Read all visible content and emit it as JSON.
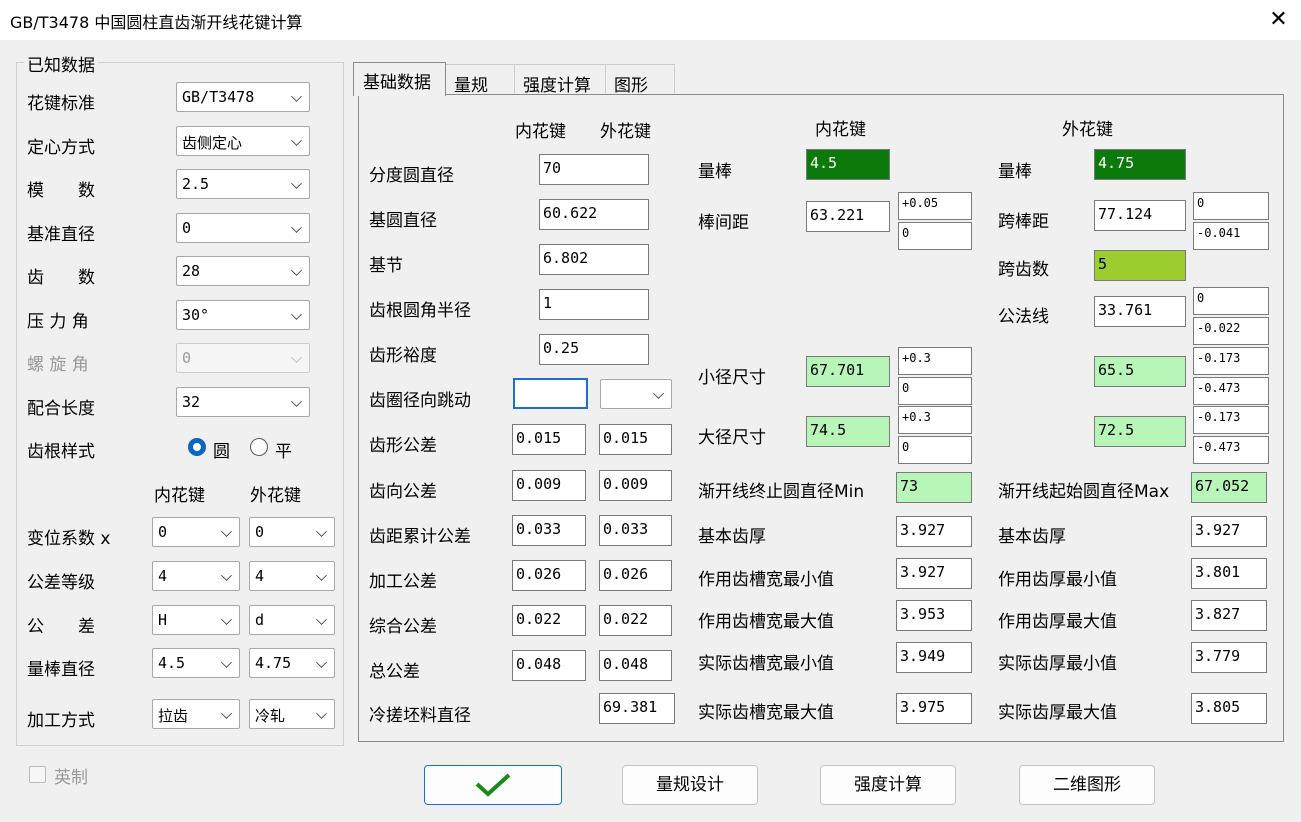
{
  "window": {
    "title": "GB/T3478 中国圆柱直齿渐开线花键计算",
    "close_glyph": "✕"
  },
  "known": {
    "group_title": "已知数据",
    "spline_standard": {
      "label": "花键标准",
      "value": "GB/T3478"
    },
    "centering": {
      "label": "定心方式",
      "value": "齿侧定心"
    },
    "module": {
      "label": "模　　数",
      "value": "2.5"
    },
    "ref_diameter": {
      "label": "基准直径",
      "value": "0"
    },
    "teeth": {
      "label": "齿　　数",
      "value": "28"
    },
    "pressure_angle": {
      "label": "压 力 角",
      "value": "30°"
    },
    "helix_angle": {
      "label": "螺 旋 角",
      "value": "0"
    },
    "fit_length": {
      "label": "配合长度",
      "value": "32"
    },
    "root_style": {
      "label": "齿根样式",
      "opt1": "圆",
      "opt2": "平",
      "selected": "圆"
    },
    "col_internal": "内花键",
    "col_external": "外花键",
    "shift": {
      "label": "变位系数 x",
      "internal": "0",
      "external": "0"
    },
    "tol_grade": {
      "label": "公差等级",
      "internal": "4",
      "external": "4"
    },
    "tolerance": {
      "label": "公　　差",
      "internal": "H",
      "external": "d"
    },
    "pin_dia": {
      "label": "量棒直径",
      "internal": "4.5",
      "external": "4.75"
    },
    "process": {
      "label": "加工方式",
      "internal": "拉齿",
      "external": "冷轧"
    },
    "imperial": "英制"
  },
  "tabs": [
    "基础数据",
    "量规",
    "强度计算",
    "图形"
  ],
  "basic": {
    "hdr_internal": "内花键",
    "hdr_external": "外花键",
    "pitch_dia": {
      "label": "分度圆直径",
      "value": "70"
    },
    "base_dia": {
      "label": "基圆直径",
      "value": "60.622"
    },
    "base_pitch": {
      "label": "基节",
      "value": "6.802"
    },
    "root_fillet": {
      "label": "齿根圆角半径",
      "value": "1"
    },
    "form_clearance": {
      "label": "齿形裕度",
      "value": "0.25"
    },
    "runout": {
      "label": "齿圈径向跳动",
      "internal": "",
      "external": ""
    },
    "profile_tol": {
      "label": "齿形公差",
      "internal": "0.015",
      "external": "0.015"
    },
    "lead_tol": {
      "label": "齿向公差",
      "internal": "0.009",
      "external": "0.009"
    },
    "cum_pitch_tol": {
      "label": "齿距累计公差",
      "internal": "0.033",
      "external": "0.033"
    },
    "mach_tol": {
      "label": "加工公差",
      "internal": "0.026",
      "external": "0.026"
    },
    "comp_tol": {
      "label": "综合公差",
      "internal": "0.022",
      "external": "0.022"
    },
    "total_tol": {
      "label": "总公差",
      "internal": "0.048",
      "external": "0.048"
    },
    "blank_dia": {
      "label": "冷搓坯料直径",
      "external": "69.381"
    }
  },
  "internal": {
    "title": "内花键",
    "pin": {
      "label": "量棒",
      "value": "4.5"
    },
    "between_pins": {
      "label": "棒间距",
      "value": "63.221",
      "upper": "+0.05",
      "lower": "0"
    },
    "minor": {
      "label": "小径尺寸",
      "value": "67.701",
      "upper": "+0.3",
      "lower": "0"
    },
    "major": {
      "label": "大径尺寸",
      "value": "74.5",
      "upper": "+0.3",
      "lower": "0"
    },
    "involute_end": {
      "label": "渐开线终止圆直径Min",
      "value": "73"
    },
    "basic_thick": {
      "label": "基本齿厚",
      "value": "3.927"
    },
    "eff_space_min": {
      "label": "作用齿槽宽最小值",
      "value": "3.927"
    },
    "eff_space_max": {
      "label": "作用齿槽宽最大值",
      "value": "3.953"
    },
    "act_space_min": {
      "label": "实际齿槽宽最小值",
      "value": "3.949"
    },
    "act_space_max": {
      "label": "实际齿槽宽最大值",
      "value": "3.975"
    }
  },
  "external": {
    "title": "外花键",
    "pin": {
      "label": "量棒",
      "value": "4.75"
    },
    "over_pins": {
      "label": "跨棒距",
      "value": "77.124",
      "upper": "0",
      "lower": "-0.041"
    },
    "span_teeth": {
      "label": "跨齿数",
      "value": "5"
    },
    "common_normal": {
      "label": "公法线",
      "value": "33.761",
      "upper": "0",
      "lower": "-0.022"
    },
    "minor": {
      "value": "65.5",
      "upper": "-0.173",
      "lower": "-0.473"
    },
    "major": {
      "value": "72.5",
      "upper": "-0.173",
      "lower": "-0.473"
    },
    "involute_start": {
      "label": "渐开线起始圆直径Max",
      "value": "67.052"
    },
    "basic_thick": {
      "label": "基本齿厚",
      "value": "3.927"
    },
    "eff_thick_min": {
      "label": "作用齿厚最小值",
      "value": "3.801"
    },
    "eff_thick_max": {
      "label": "作用齿厚最大值",
      "value": "3.827"
    },
    "act_thick_min": {
      "label": "实际齿厚最小值",
      "value": "3.779"
    },
    "act_thick_max": {
      "label": "实际齿厚最大值",
      "value": "3.805"
    }
  },
  "buttons": {
    "gauge": "量规设计",
    "strength": "强度计算",
    "graphics": "二维图形"
  },
  "colors": {
    "dark_green": "#0b7a0b",
    "yellow_green": "#9bcd2e",
    "light_green": "#b8f5b8",
    "check": "#1a8a1a"
  }
}
